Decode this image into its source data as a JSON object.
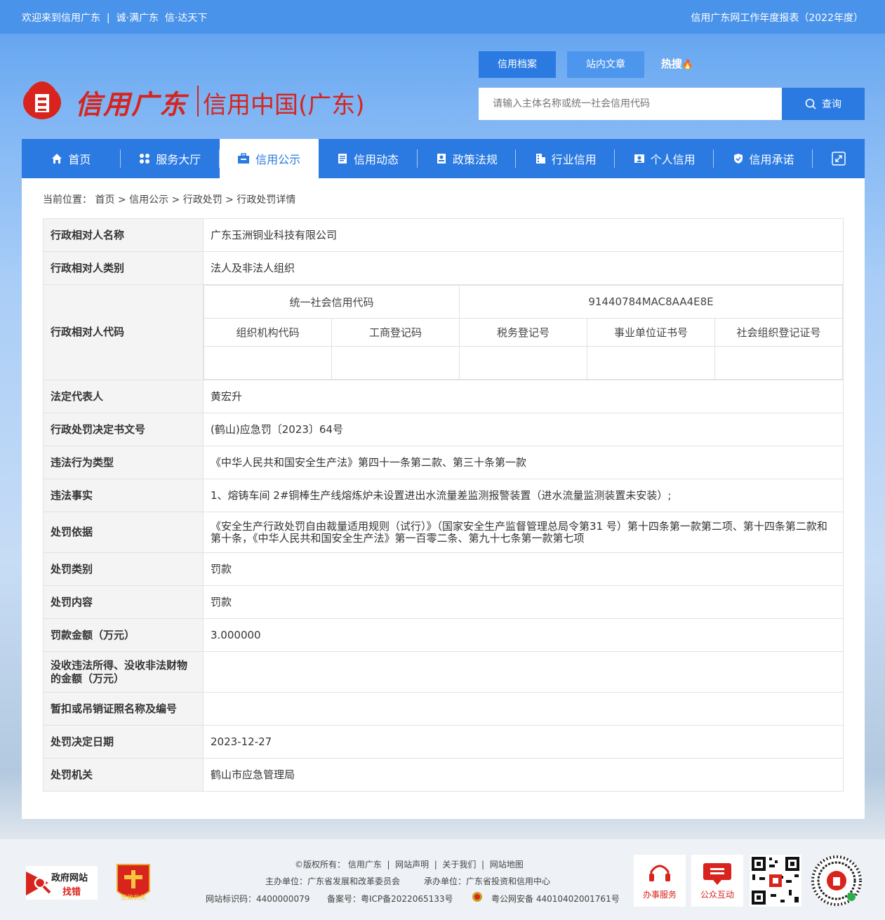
{
  "topbar": {
    "welcome": "欢迎来到信用广东  |  诚·满广东  信·达天下",
    "report_link": "信用广东网工作年度报表（2022年度）"
  },
  "logo": {
    "name_calligraphy": "信用广东",
    "name_cn": "信用中国(广东)"
  },
  "search": {
    "tabs": [
      "信用档案",
      "站内文章"
    ],
    "hot_label": "热搜",
    "placeholder": "请输入主体名称或统一社会信用代码",
    "button_label": "查询"
  },
  "nav": {
    "items": [
      "首页",
      "服务大厅",
      "信用公示",
      "信用动态",
      "政策法规",
      "行业信用",
      "个人信用",
      "信用承诺"
    ],
    "active_index": 2
  },
  "breadcrumb": "当前位置： 首页 > 信用公示 > 行政处罚 > 行政处罚详情",
  "detail": {
    "party_name_label": "行政相对人名称",
    "party_name": "广东玉洲铜业科技有限公司",
    "party_type_label": "行政相对人类别",
    "party_type": "法人及非法人组织",
    "party_code_label": "行政相对人代码",
    "uscc_label": "统一社会信用代码",
    "uscc_value": "91440784MAC8AA4E8E",
    "code_headers": [
      "组织机构代码",
      "工商登记码",
      "税务登记号",
      "事业单位证书号",
      "社会组织登记证号"
    ],
    "code_values": [
      "",
      "",
      "",
      "",
      ""
    ],
    "rows": [
      {
        "label": "法定代表人",
        "value": "黄宏升"
      },
      {
        "label": "行政处罚决定书文号",
        "value": "(鹤山)应急罚〔2023〕64号"
      },
      {
        "label": "违法行为类型",
        "value": "《中华人民共和国安全生产法》第四十一条第二款、第三十条第一款"
      },
      {
        "label": "违法事实",
        "value": "1、熔铸车间 2#铜棒生产线熔炼炉未设置进出水流量差监测报警装置（进水流量监测装置未安装）;"
      },
      {
        "label": "处罚依据",
        "value": "《安全生产行政处罚自由裁量适用规则（试行）》（国家安全生产监督管理总局令第31 号）第十四条第一款第二项、第十四条第二款和第十条，《中华人民共和国安全生产法》第一百零二条、第九十七条第一款第七项"
      },
      {
        "label": "处罚类别",
        "value": "罚款"
      },
      {
        "label": "处罚内容",
        "value": "罚款"
      },
      {
        "label": "罚款金额（万元）",
        "value": "3.000000"
      },
      {
        "label": "没收违法所得、没收非法财物的金额（万元）",
        "value": ""
      },
      {
        "label": "暂扣或吊销证照名称及编号",
        "value": ""
      },
      {
        "label": "处罚决定日期",
        "value": "2023-12-27"
      },
      {
        "label": "处罚机关",
        "value": "鹤山市应急管理局"
      }
    ]
  },
  "footer": {
    "badge_gov_line1": "政府网站",
    "badge_gov_line2": "找错",
    "badge_party": "党政机关",
    "line1": "©版权所有： 信用广东  |  网站声明  |  关于我们  |  网站地图",
    "line2a": "主办单位：广东省发展和改革委员会",
    "line2b": "承办单位：广东省投资和信用中心",
    "line3a": "网站标识码：4400000079",
    "line3b": "备案号：粤ICP备2022065133号",
    "line3c": "粤公网安备 44010402001761号",
    "tile1": "办事服务",
    "tile2": "公众互动"
  },
  "colors": {
    "primary": "#2a7ae2",
    "topbar": "#4a93ea",
    "brand_red": "#d8241c"
  }
}
